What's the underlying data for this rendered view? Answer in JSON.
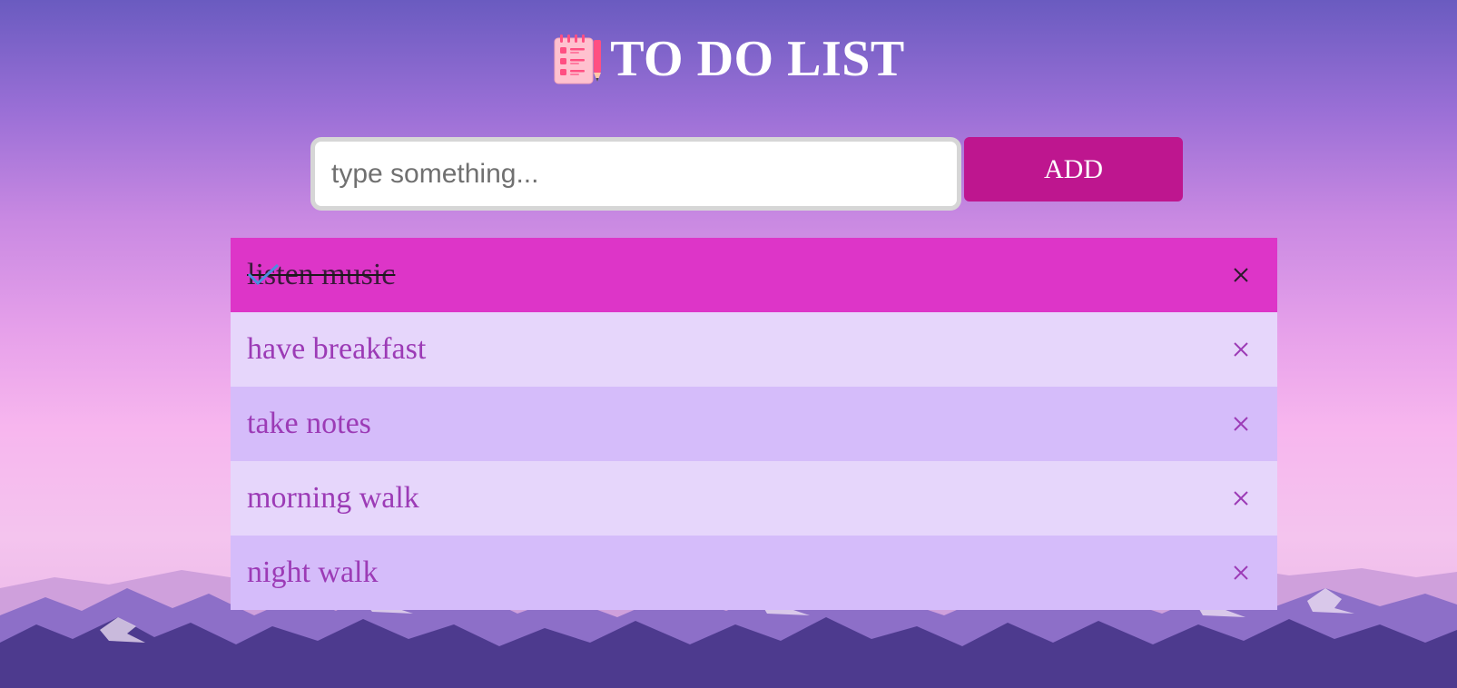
{
  "header": {
    "title": "TO DO LIST",
    "icon": "notepad-icon"
  },
  "input": {
    "value": "",
    "placeholder": "type something..."
  },
  "add_button": {
    "label": "ADD"
  },
  "todos": [
    {
      "text": "listen music",
      "checked": true
    },
    {
      "text": "have breakfast",
      "checked": false
    },
    {
      "text": "take notes",
      "checked": false
    },
    {
      "text": "morning walk",
      "checked": false
    },
    {
      "text": "night walk",
      "checked": false
    }
  ],
  "icons": {
    "check": "check-icon",
    "close": "close-icon"
  },
  "colors": {
    "accent": "#be168f",
    "checked_row": "#dd35c8",
    "row_light": "#e6d6fb",
    "row_mid": "#d5bcfa",
    "item_text": "#9c3bb6",
    "check_mark": "#4a8ee0"
  }
}
